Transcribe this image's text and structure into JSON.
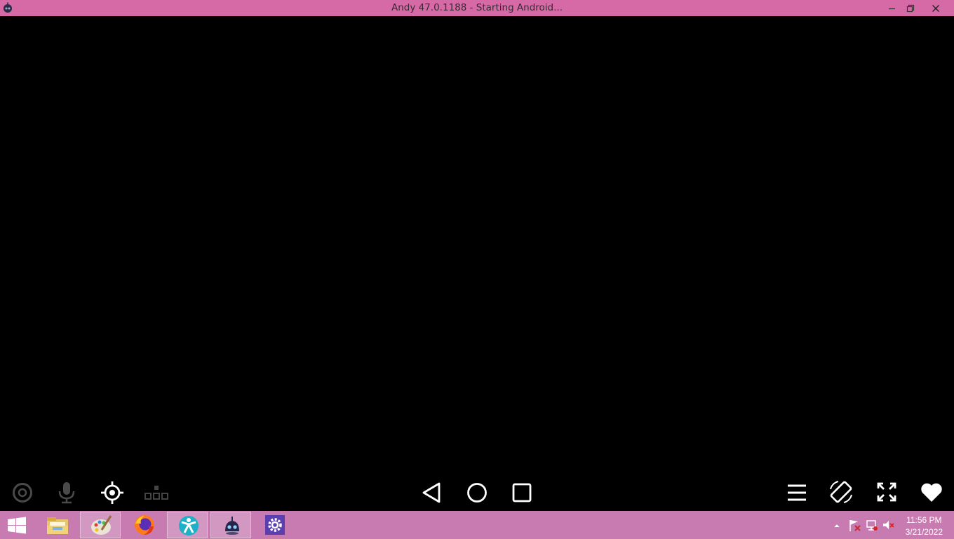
{
  "window": {
    "title": "Andy 47.0.1188 - Starting Android...",
    "app_icon": "andy-robot-icon",
    "controls": [
      "minimize-icon",
      "restore-icon",
      "close-icon"
    ],
    "titlebar_color": "#d56aa6"
  },
  "emulator": {
    "left_tools": [
      "camera-icon",
      "microphone-icon",
      "location-icon",
      "keyboard-mapping-icon"
    ],
    "nav_buttons": [
      "back-icon",
      "home-icon",
      "recents-icon"
    ],
    "right_tools": [
      "menu-icon",
      "rotate-icon",
      "fullscreen-icon",
      "favorite-icon"
    ]
  },
  "taskbar": {
    "color": "#c77bb0",
    "apps": [
      "start-icon",
      "file-explorer-icon",
      "paint-icon",
      "firefox-icon",
      "accessibility-app-icon",
      "andy-icon",
      "settings-icon"
    ],
    "tray": [
      "show-hidden-icons",
      "action-center-flag-icon",
      "network-icon",
      "volume-muted-icon"
    ],
    "clock": {
      "time": "11:56 PM",
      "date": "3/21/2022"
    }
  }
}
